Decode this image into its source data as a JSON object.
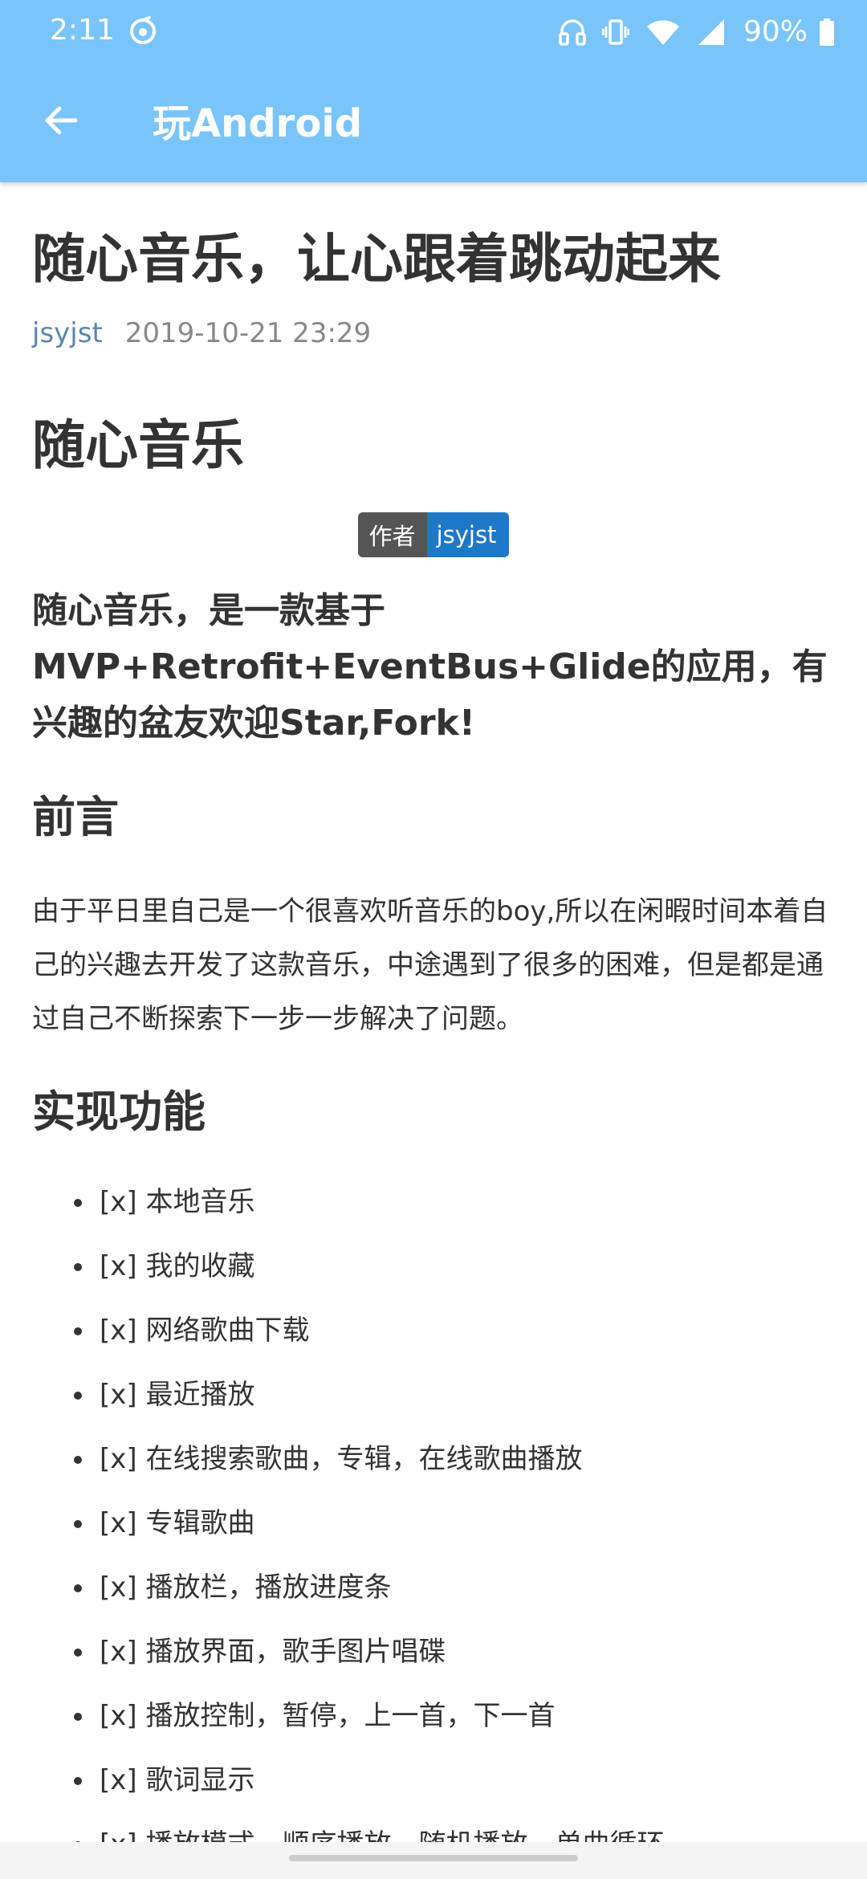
{
  "status_bar": {
    "time": "2:11",
    "battery_percent": "90%",
    "icons": [
      "app-notification-icon",
      "headphones-icon",
      "vibrate-icon",
      "wifi-icon",
      "signal-icon",
      "battery-icon"
    ]
  },
  "toolbar": {
    "title": "玩Android",
    "back_icon": "arrow-left-icon",
    "background_color": "#79c4fb"
  },
  "article": {
    "title": "随心音乐，让心跟着跳动起来",
    "author": "jsyjst",
    "date": "2019-10-21 23:29",
    "heading": "随心音乐",
    "badge": {
      "label": "作者",
      "value": "jsyjst",
      "label_color": "#555555",
      "value_color": "#1e78c8"
    },
    "intro": "随心音乐，是一款基于MVP+Retrofit+EventBus+Glide的应用，有兴趣的盆友欢迎Star,Fork!",
    "preface_heading": "前言",
    "preface_text": "由于平日里自己是一个很喜欢听音乐的boy,所以在闲暇时间本着自己的兴趣去开发了这款音乐，中途遇到了很多的困难，但是都是通过自己不断探索下一步一步解决了问题。",
    "features_heading": "实现功能",
    "features": [
      "[x] 本地音乐",
      "[x] 我的收藏",
      "[x] 网络歌曲下载",
      "[x] 最近播放",
      "[x] 在线搜索歌曲，专辑，在线歌曲播放",
      "[x] 专辑歌曲",
      "[x] 播放栏，播放进度条",
      "[x] 播放界面，歌手图片唱碟",
      "[x] 播放控制，暂停，上一首，下一首",
      "[x] 歌词显示",
      "[x] 播放模式，顺序播放，随机播放，单曲循环"
    ]
  }
}
